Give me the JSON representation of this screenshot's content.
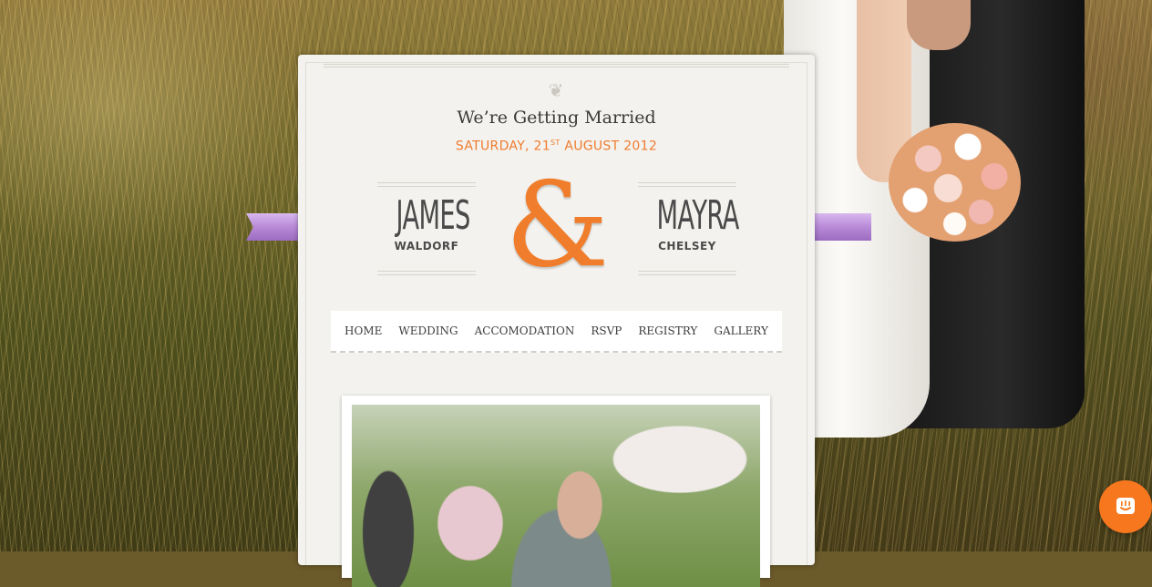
{
  "header": {
    "headline": "We’re Getting Married",
    "date_prefix": "SATURDAY, 21",
    "date_suffix": "ST",
    "date_rest": " AUGUST 2012"
  },
  "couple": {
    "groom_first": "JAMES",
    "groom_last": "WALDORF",
    "ampersand": "&",
    "bride_first": "MAYRA",
    "bride_last": "CHELSEY"
  },
  "nav": {
    "items": [
      "HOME",
      "WEDDING",
      "ACCOMODATION",
      "RSVP",
      "REGISTRY",
      "GALLERY"
    ]
  },
  "colors": {
    "accent": "#f07b2e",
    "ribbon": "#b88ad8",
    "paper": "#f3f2ee",
    "chat_button": "#f7771e"
  },
  "icons": {
    "flourish": "ornament-flourish-icon",
    "chat": "chat-bubble-icon"
  }
}
